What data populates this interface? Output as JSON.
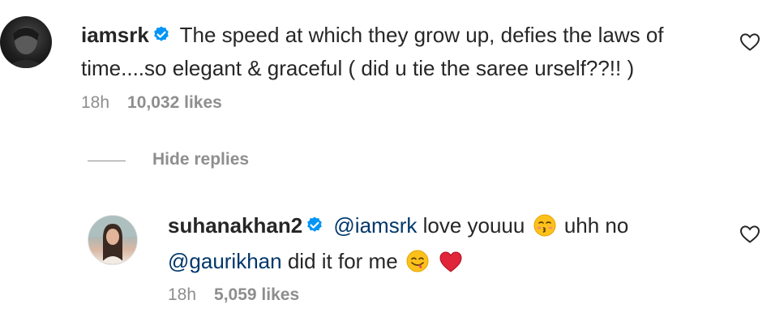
{
  "comment": {
    "username": "iamsrk",
    "text": "The speed at which they grow up, defies the laws of time....so elegant & graceful ( did u tie the saree urself??!! )",
    "time": "18h",
    "likes": "10,032 likes"
  },
  "replies_toggle": {
    "label": "Hide replies"
  },
  "reply": {
    "username": "suhanakhan2",
    "mention_1": "@iamsrk",
    "text_1": "love youuu",
    "text_2": "uhh no",
    "mention_2": "@gaurikhan",
    "text_3": "did it for me",
    "time": "18h",
    "likes": "5,059 likes"
  },
  "colors": {
    "verified_badge": "#0095f6",
    "mention": "#00376b",
    "meta": "#8e8e8e"
  },
  "icons": [
    "verified-badge-icon",
    "heart-outline-icon",
    "kissing-face-emoji",
    "yum-face-emoji",
    "red-heart-emoji"
  ]
}
